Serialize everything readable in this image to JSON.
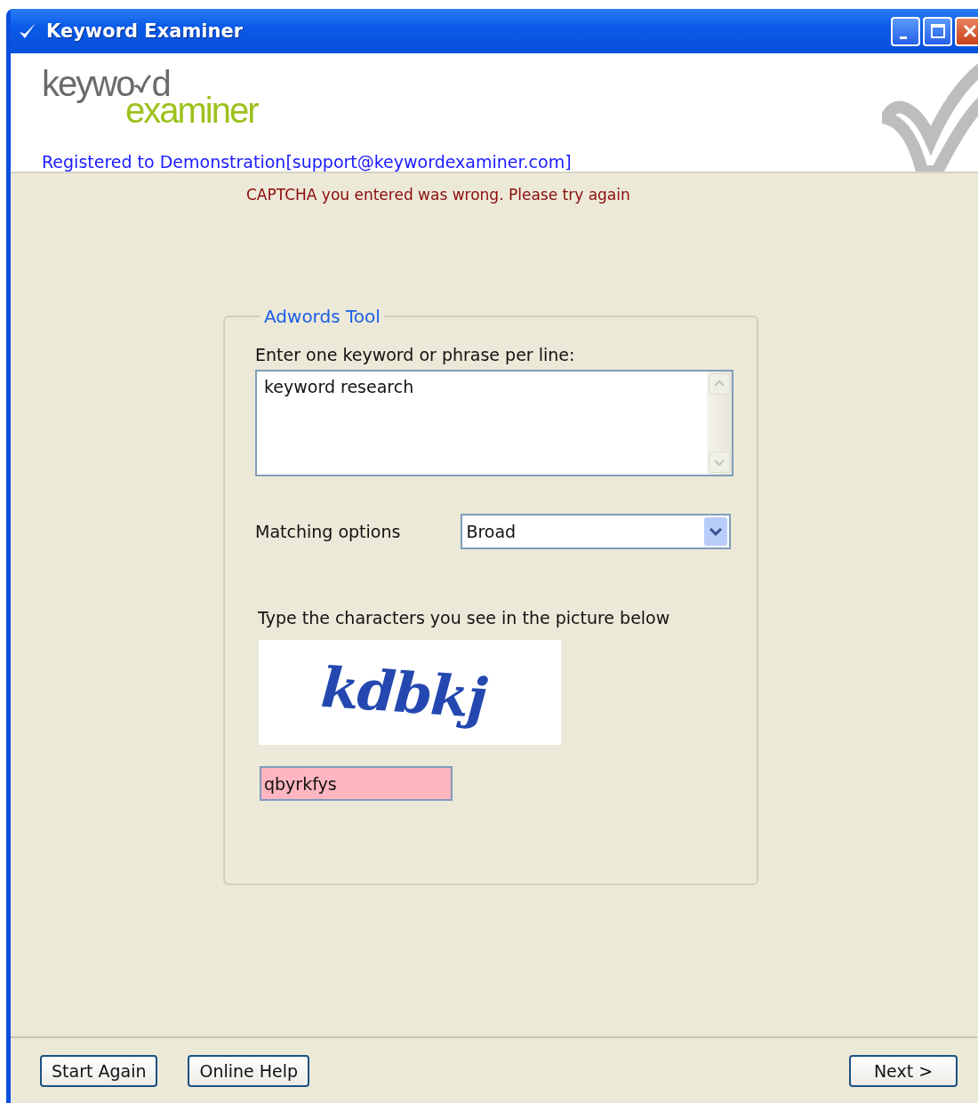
{
  "window": {
    "title": "Keyword Examiner"
  },
  "logo": {
    "top_start": "keywo",
    "top_end": "d",
    "bottom": "examiner"
  },
  "registration": "Registered to Demonstration[support@keywordexaminer.com]",
  "error_message": "CAPTCHA you entered was wrong. Please try again",
  "group": {
    "title": "Adwords Tool",
    "keywords": {
      "label": "Enter one keyword or phrase per line:",
      "value": "keyword research"
    },
    "matching": {
      "label": "Matching options",
      "value": "Broad"
    },
    "captcha": {
      "prompt": "Type the characters you see in the picture below",
      "image_text": "kdbkj",
      "value": "qbyrkfys",
      "invalid": true
    }
  },
  "buttons": [
    {
      "label": "Start Again"
    },
    {
      "label": "Online Help"
    },
    {
      "label": "Next >"
    }
  ]
}
